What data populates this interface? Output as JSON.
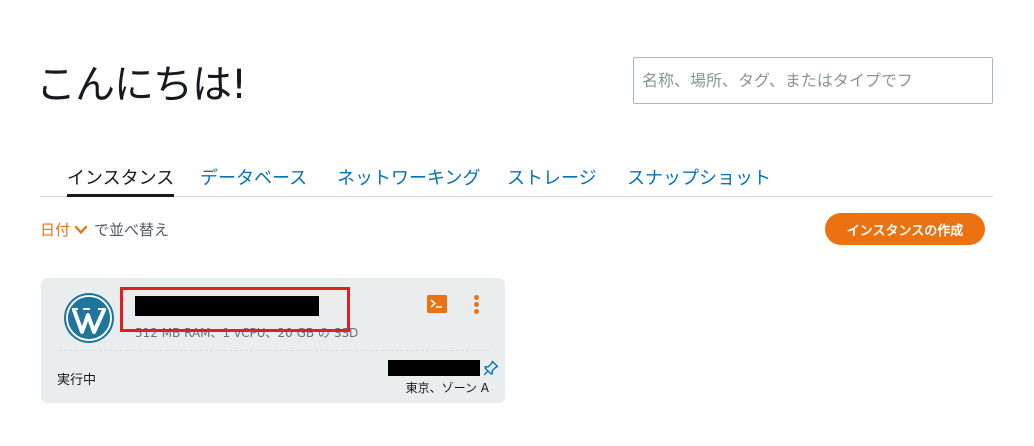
{
  "header": {
    "greeting": "こんにちは!",
    "search_placeholder": "名称、場所、タグ、またはタイプでフ"
  },
  "tabs": [
    {
      "label": "インスタンス",
      "active": true
    },
    {
      "label": "データベース",
      "active": false
    },
    {
      "label": "ネットワーキング",
      "active": false
    },
    {
      "label": "ストレージ",
      "active": false
    },
    {
      "label": "スナップショット",
      "active": false
    }
  ],
  "sort": {
    "key": "日付",
    "suffix": "で並べ替え"
  },
  "create_button": "インスタンスの作成",
  "instance": {
    "name": "",
    "spec": "512 MB RAM、1 vCPU、20 GB の SSD",
    "status": "実行中",
    "zone": "東京、ゾーン A",
    "icons": [
      "wordpress-icon",
      "terminal-icon",
      "more-options-icon",
      "pin-icon"
    ]
  },
  "colors": {
    "accent": "#ec7211",
    "link": "#0073bb",
    "card_bg": "#eaeded",
    "highlight": "#e02020"
  }
}
